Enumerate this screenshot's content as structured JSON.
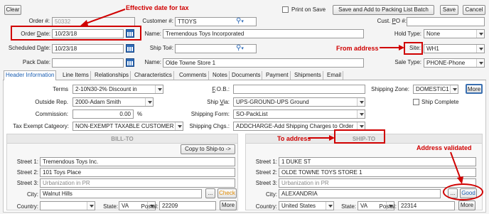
{
  "toolbar": {
    "clear": "Clear",
    "print_on_save": "Print on Save",
    "save_add_packing": "Save and Add to Packing List Batch",
    "save": "Save",
    "cancel": "Cancel"
  },
  "header": {
    "order_no_label": "Order #:",
    "order_no": "50332",
    "customer_label": "Customer #:",
    "customer": "TTOYS",
    "cust_po_label": "Cust. PO #:",
    "cust_po": "",
    "order_date_label": "Order Date:",
    "order_date": "10/23/18",
    "name_label": "Name:",
    "name": "Tremendous Toys Incorporated",
    "hold_type_label": "Hold Type:",
    "hold_type": "None",
    "scheduled_date_label": "Scheduled Date:",
    "scheduled_date": "10/23/18",
    "ship_to_label": "Ship To#:",
    "ship_to": "",
    "site_label": "Site:",
    "site": "WH1",
    "pack_date_label": "Pack Date:",
    "pack_date": "",
    "ship_name_label": "Name:",
    "ship_name": "Olde Towne Store 1",
    "sale_type_label": "Sale Type:",
    "sale_type": "PHONE-Phone"
  },
  "tabs": [
    "Header Information",
    "Line Items",
    "Relationships",
    "Characteristics",
    "Comments",
    "Notes",
    "Documents",
    "Payment",
    "Shipments",
    "Email"
  ],
  "header_info": {
    "terms_label": "Terms",
    "terms": "2-10N30-2% Discount in",
    "fob_label": "F.O.B.:",
    "fob": "",
    "shipping_zone_label": "Shipping Zone:",
    "shipping_zone": "DOMESTIC1",
    "more": "More",
    "outside_rep_label": "Outside Rep.",
    "outside_rep": "2000-Adam Smith",
    "ship_via_label": "Ship Via:",
    "ship_via": "UPS-GROUND-UPS Ground",
    "ship_complete": "Ship Complete",
    "commission_label": "Commission:",
    "commission": "0.00",
    "commission_unit": "%",
    "shipping_form_label": "Shipping Form:",
    "shipping_form": "SO-PackList",
    "tax_exempt_label": "Tax Exempt Catgeory:",
    "tax_exempt": "NON-EXEMPT TAXABLE CUSTOMER",
    "shipping_chgs_label": "Shipping Chgs.:",
    "shipping_chgs": "ADDCHARGE-Add Shipping Charges to Order"
  },
  "bill_to": {
    "title": "BILL-TO",
    "copy_btn": "Copy to Ship-to ->",
    "street1_label": "Street 1:",
    "street1": "Tremendous Toys Inc.",
    "street2_label": "Street 2:",
    "street2": "101 Toys Place",
    "street3_label": "Street 3:",
    "street3": "Urbanization in PR",
    "city_label": "City:",
    "city": "Walnut Hills",
    "ellipsis": "...",
    "check": "Check",
    "country_label": "Country:",
    "country": "",
    "state_label": "State:",
    "state": "VA",
    "postal_label": "Postal:",
    "postal": "22209",
    "more": "More"
  },
  "ship_to": {
    "title": "SHIP-TO",
    "street1_label": "Street 1:",
    "street1": "1 DUKE ST",
    "street2_label": "Street 2:",
    "street2": "OLDE TOWNE TOYS STORE 1",
    "street3_label": "Street 3:",
    "street3": "Urbanization in PR",
    "city_label": "City:",
    "city": "ALEXANDRIA",
    "ellipsis": "...",
    "good": "Good",
    "country_label": "Country:",
    "country": "United States",
    "state_label": "State:",
    "state": "VA",
    "postal_label": "Postal:",
    "postal": "22314",
    "more": "More"
  },
  "annotations": {
    "effective_date": "Effective date for tax",
    "from_address": "From address",
    "to_address": "To address",
    "address_validated": "Address validated"
  },
  "colors": {
    "annotation_red": "#d00000",
    "tab_blue": "#1b5fb3",
    "check_orange": "#e08a00"
  }
}
